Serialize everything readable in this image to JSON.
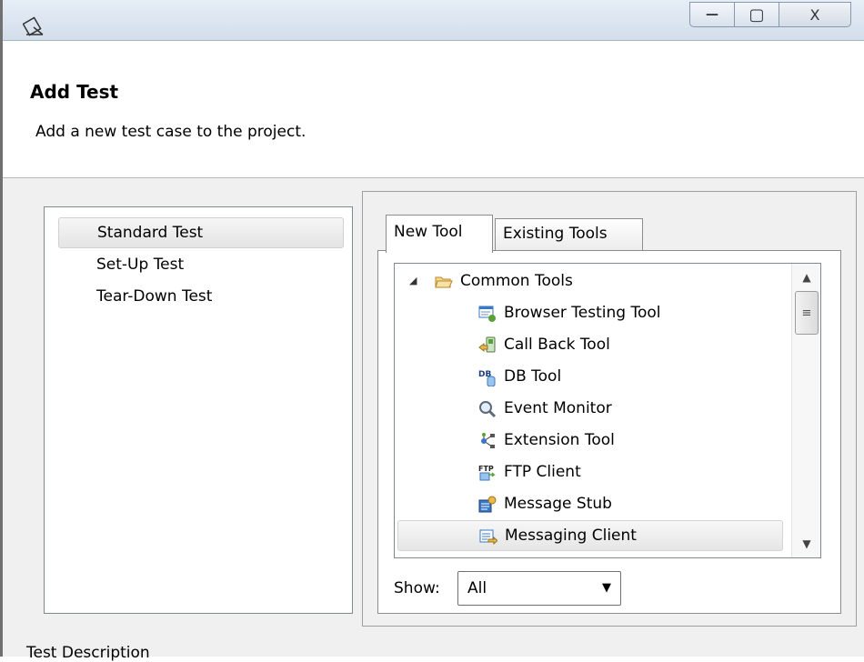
{
  "window": {
    "minimize_glyph": "—",
    "maximize_glyph": "▢",
    "close_glyph": "X"
  },
  "header": {
    "title": "Add Test",
    "subtitle": "Add a new test case to the project."
  },
  "test_types": {
    "items": [
      {
        "label": "Standard Test",
        "selected": true
      },
      {
        "label": "Set-Up Test",
        "selected": false
      },
      {
        "label": "Tear-Down Test",
        "selected": false
      }
    ]
  },
  "tabs": {
    "new_tool": "New Tool",
    "existing_tools": "Existing Tools"
  },
  "tree": {
    "root": {
      "label": "Common Tools",
      "icon": "folder-open-icon",
      "expanded": true
    },
    "items": [
      {
        "label": "Browser Testing Tool",
        "icon": "browser-testing-tool-icon"
      },
      {
        "label": "Call Back Tool",
        "icon": "call-back-tool-icon"
      },
      {
        "label": "DB Tool",
        "icon": "db-tool-icon"
      },
      {
        "label": "Event Monitor",
        "icon": "magnifier-icon"
      },
      {
        "label": "Extension Tool",
        "icon": "extension-tool-icon"
      },
      {
        "label": "FTP Client",
        "icon": "ftp-client-icon"
      },
      {
        "label": "Message Stub",
        "icon": "message-stub-icon"
      },
      {
        "label": "Messaging Client",
        "icon": "messaging-client-icon",
        "selected": true
      }
    ]
  },
  "filter": {
    "label": "Show:",
    "value": "All"
  },
  "footer": {
    "partial_text": "Test Description"
  },
  "colors": {
    "folder": "#e8b84a",
    "tool_blue": "#3a78c4",
    "tool_green": "#5aa03a"
  }
}
